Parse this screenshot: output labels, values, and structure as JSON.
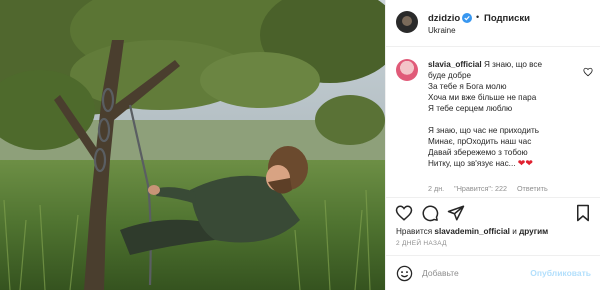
{
  "post": {
    "photo_alt": "",
    "header": {
      "username": "dzidzio",
      "dot": "•",
      "follow_label": "Подписки",
      "location": "Ukraine",
      "more": "···"
    },
    "comment": {
      "username": "slavia_official",
      "lines": [
        "Я знаю, що все",
        "буде добре",
        "За тебе я Бога молю",
        "Хоча ми вже більше не пара",
        "Я тебе серцем люблю",
        "",
        "Я знаю, що час не приходить",
        "Минає, прОходить наш час",
        "Давай збережемо з тобою",
        "Нитку, що зв'язує нас..."
      ],
      "hearts": "❤❤",
      "time": "2 дн.",
      "likes_label": "\"Нравится\": 222",
      "reply_label": "Ответить"
    },
    "liked_by": {
      "prefix": "Нравится ",
      "user": "slavademin_official",
      "connector": " и ",
      "others": "другим"
    },
    "date": "2 ДНЕЙ НАЗАД",
    "add_comment_placeholder": "Добавьте",
    "publish_label": "Опубликовать"
  },
  "colors": {
    "accent": "#0095f6",
    "publish_disabled": "#b2dffc",
    "heart": "#e0202f",
    "muted": "#8e8e8e"
  },
  "icons": {
    "verified": "verified-badge-icon",
    "like": "heart-icon",
    "comment": "comment-icon",
    "share": "paper-plane-icon",
    "save": "bookmark-icon",
    "emoji": "smiley-icon"
  }
}
